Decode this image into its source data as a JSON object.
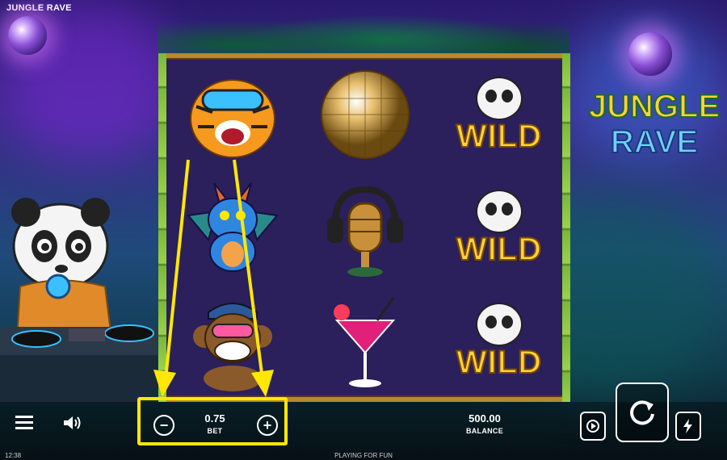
{
  "game_title": "JUNGLE RAVE",
  "logo": {
    "line1": "JUNGLE",
    "line2": "RAVE"
  },
  "reels": [
    [
      {
        "symbol": "tiger-with-goggles"
      },
      {
        "symbol": "blue-dragon"
      },
      {
        "symbol": "monkey-with-cap"
      }
    ],
    [
      {
        "symbol": "disco-ball"
      },
      {
        "symbol": "microphone-with-headphones"
      },
      {
        "symbol": "cocktail-glass"
      }
    ],
    [
      {
        "symbol": "panda-wild",
        "label": "WILD"
      },
      {
        "symbol": "panda-wild",
        "label": "WILD"
      },
      {
        "symbol": "panda-wild",
        "label": "WILD"
      }
    ]
  ],
  "bet": {
    "value": "0.75",
    "label": "BET",
    "minus": "−",
    "plus": "+"
  },
  "balance": {
    "value": "500.00",
    "label": "BALANCE"
  },
  "footer": {
    "clock": "12:38",
    "center_text": "PLAYING FOR FUN"
  },
  "colors": {
    "frame": "#b8892e",
    "highlight": "#ffe800",
    "wild_text": "#ffd23a"
  }
}
